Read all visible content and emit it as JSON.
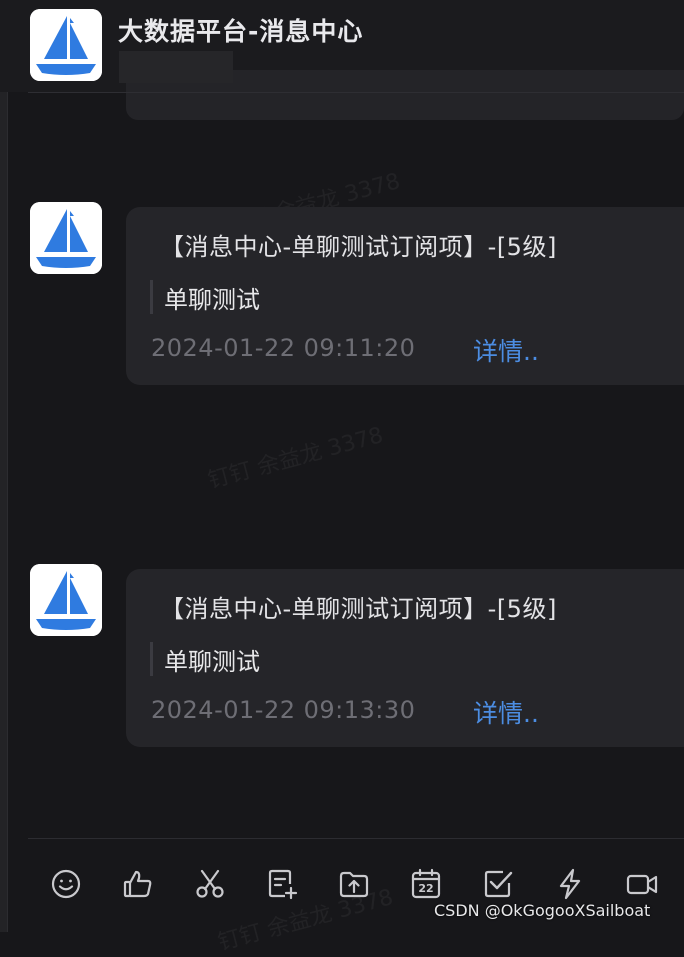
{
  "header": {
    "title": "大数据平台-消息中心"
  },
  "watermark_text": "钉钉 余益龙 3378",
  "messages": [
    {
      "title": "【消息中心-单聊测试订阅项】-[5级]",
      "body": "单聊测试",
      "time": "2024-01-22 09:11:20",
      "detail_label": "详情.."
    },
    {
      "title": "【消息中心-单聊测试订阅项】-[5级]",
      "body": "单聊测试",
      "time": "2024-01-22 09:13:30",
      "detail_label": "详情.."
    }
  ],
  "toolbar": {
    "icons": [
      "emoji-icon",
      "thumbs-up-icon",
      "scissors-icon",
      "document-add-icon",
      "upload-folder-icon",
      "calendar-icon",
      "checkbox-icon",
      "lightning-icon",
      "video-icon"
    ],
    "calendar_day": "22"
  },
  "credit": "CSDN @OkGogooXSailboat",
  "colors": {
    "background": "#17171a",
    "card": "#252529",
    "link": "#4c8de2",
    "brand_blue": "#2f7be0"
  }
}
